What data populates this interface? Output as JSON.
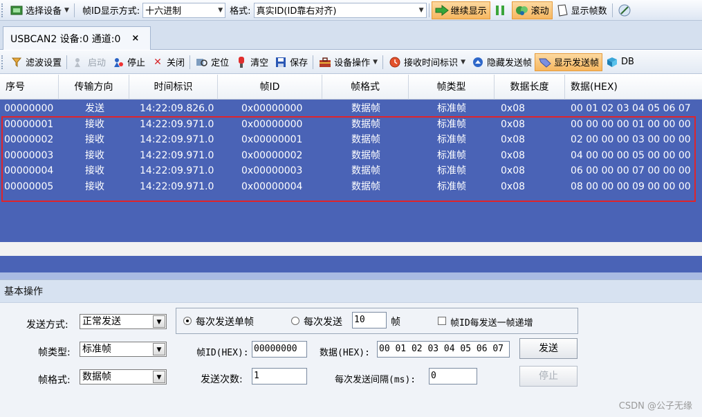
{
  "toolbar1": {
    "select_device": "选择设备",
    "frame_id_mode_label": "帧ID显示方式:",
    "frame_id_mode_value": "十六进制",
    "format_label": "格式:",
    "format_value": "真实ID(ID靠右对齐)",
    "continue_display": "继续显示",
    "scroll": "滚动",
    "show_frame_count": "显示帧数"
  },
  "tab": {
    "label": "USBCAN2 设备:0 通道:0",
    "close": "×"
  },
  "toolbar2": {
    "filter": "滤波设置",
    "start": "启动",
    "stop": "停止",
    "close": "关闭",
    "locate": "定位",
    "clear": "清空",
    "save": "保存",
    "device_ops": "设备操作",
    "rx_time": "接收时间标识",
    "hide_tx": "隐藏发送帧",
    "show_tx": "显示发送帧",
    "dbc": "DB"
  },
  "grid": {
    "columns": [
      "序号",
      "传输方向",
      "时间标识",
      "帧ID",
      "帧格式",
      "帧类型",
      "数据长度",
      "数据(HEX)"
    ],
    "rows": [
      [
        "00000000",
        "发送",
        "14:22:09.826.0",
        "0x00000000",
        "数据帧",
        "标准帧",
        "0x08",
        "00 01 02 03 04 05 06 07"
      ],
      [
        "00000001",
        "接收",
        "14:22:09.971.0",
        "0x00000000",
        "数据帧",
        "标准帧",
        "0x08",
        "00 00 00 00 01 00 00 00"
      ],
      [
        "00000002",
        "接收",
        "14:22:09.971.0",
        "0x00000001",
        "数据帧",
        "标准帧",
        "0x08",
        "02 00 00 00 03 00 00 00"
      ],
      [
        "00000003",
        "接收",
        "14:22:09.971.0",
        "0x00000002",
        "数据帧",
        "标准帧",
        "0x08",
        "04 00 00 00 05 00 00 00"
      ],
      [
        "00000004",
        "接收",
        "14:22:09.971.0",
        "0x00000003",
        "数据帧",
        "标准帧",
        "0x08",
        "06 00 00 00 07 00 00 00"
      ],
      [
        "00000005",
        "接收",
        "14:22:09.971.0",
        "0x00000004",
        "数据帧",
        "标准帧",
        "0x08",
        "08 00 00 00 09 00 00 00"
      ]
    ]
  },
  "panel": {
    "title": "基本操作",
    "send_mode_label": "发送方式:",
    "send_mode_value": "正常发送",
    "frame_type_label": "帧类型:",
    "frame_type_value": "标准帧",
    "frame_format_label": "帧格式:",
    "frame_format_value": "数据帧",
    "radio_single": "每次发送单帧",
    "radio_multi": "每次发送",
    "multi_count": "10",
    "multi_unit": "帧",
    "increment_label": "帧ID每发送一帧递增",
    "frame_id_label": "帧ID(HEX):",
    "frame_id_value": "00000000",
    "data_label": "数据(HEX):",
    "data_value": "00 01 02 03 04 05 06 07",
    "send_button": "发送",
    "send_count_label": "发送次数:",
    "send_count_value": "1",
    "interval_label": "每次发送间隔(ms):",
    "interval_value": "0",
    "stop_button": "停止"
  },
  "watermark": "CSDN @公子无缘",
  "colors": {
    "grid_bg": "#4a63b6",
    "highlight": "#e0242a",
    "accent": "#f6b760"
  }
}
